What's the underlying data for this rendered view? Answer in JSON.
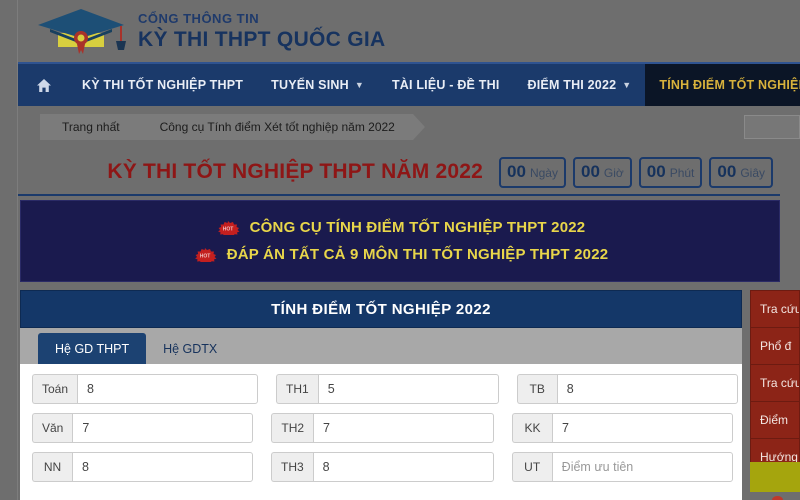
{
  "branding": {
    "line1": "CỔNG THÔNG TIN",
    "line2": "KỲ THI THPT QUỐC GIA",
    "logo_icon": "graduation-cap-icon",
    "cap_color": "#1d4f76",
    "band_color": "#d8cf3f",
    "medal_color": "#a8322a"
  },
  "nav": {
    "home_icon": "home-icon",
    "items": [
      {
        "label": "KỲ THI TỐT NGHIỆP THPT",
        "has_caret": false,
        "active": false
      },
      {
        "label": "TUYỂN SINH",
        "has_caret": true,
        "active": false
      },
      {
        "label": "TÀI LIỆU - ĐỀ THI",
        "has_caret": false,
        "active": false
      },
      {
        "label": "ĐIỂM THI 2022",
        "has_caret": true,
        "active": false
      },
      {
        "label": "TÍNH ĐIỂM TỐT NGHIỆP",
        "has_caret": false,
        "active": true
      }
    ],
    "active_color": "#d8b23c",
    "bar_color": "#1b3a6b"
  },
  "breadcrumb": {
    "items": [
      "Trang nhất",
      "Công cụ Tính điểm Xét tốt nghiệp năm 2022"
    ],
    "search_placeholder": ""
  },
  "countdown": {
    "title": "KỲ THI TỐT NGHIỆP THPT NĂM 2022",
    "title_color": "#8e1616",
    "boxes": [
      {
        "value": "00",
        "unit": "Ngày"
      },
      {
        "value": "00",
        "unit": "Giờ"
      },
      {
        "value": "00",
        "unit": "Phút"
      },
      {
        "value": "00",
        "unit": "Giây"
      }
    ]
  },
  "promo": {
    "background": "#1a1a4e",
    "text_color": "#e8d64a",
    "rows": [
      {
        "badge": "hot-badge-icon",
        "text": "CÔNG CỤ TÍNH ĐIỂM TỐT NGHIỆP THPT 2022"
      },
      {
        "badge": "hot-badge-icon",
        "text": "ĐÁP ÁN TẤT CẢ 9 MÔN THI TỐT NGHIỆP THPT 2022"
      }
    ]
  },
  "calculator": {
    "title": "TÍNH ĐIỂM TỐT NGHIỆP 2022",
    "tabs": [
      {
        "label": "Hệ GD THPT",
        "active": true
      },
      {
        "label": "Hệ GDTX",
        "active": false
      }
    ],
    "rows": [
      [
        {
          "label": "Toán",
          "value": "8",
          "placeholder": ""
        },
        {
          "label": "TH1",
          "value": "5",
          "placeholder": ""
        },
        {
          "label": "TB",
          "value": "8",
          "placeholder": ""
        }
      ],
      [
        {
          "label": "Văn",
          "value": "7",
          "placeholder": ""
        },
        {
          "label": "TH2",
          "value": "7",
          "placeholder": ""
        },
        {
          "label": "KK",
          "value": "7",
          "placeholder": ""
        }
      ],
      [
        {
          "label": "NN",
          "value": "8",
          "placeholder": ""
        },
        {
          "label": "TH3",
          "value": "8",
          "placeholder": ""
        },
        {
          "label": "UT",
          "value": "",
          "placeholder": "Điểm ưu tiên"
        }
      ]
    ]
  },
  "sidebar": {
    "background": "#8c2417",
    "items": [
      {
        "label": "Tra cứu"
      },
      {
        "label": "Phổ đ"
      },
      {
        "label": "Tra cứu"
      },
      {
        "label": "Điểm"
      },
      {
        "label": "Hướng"
      }
    ]
  }
}
